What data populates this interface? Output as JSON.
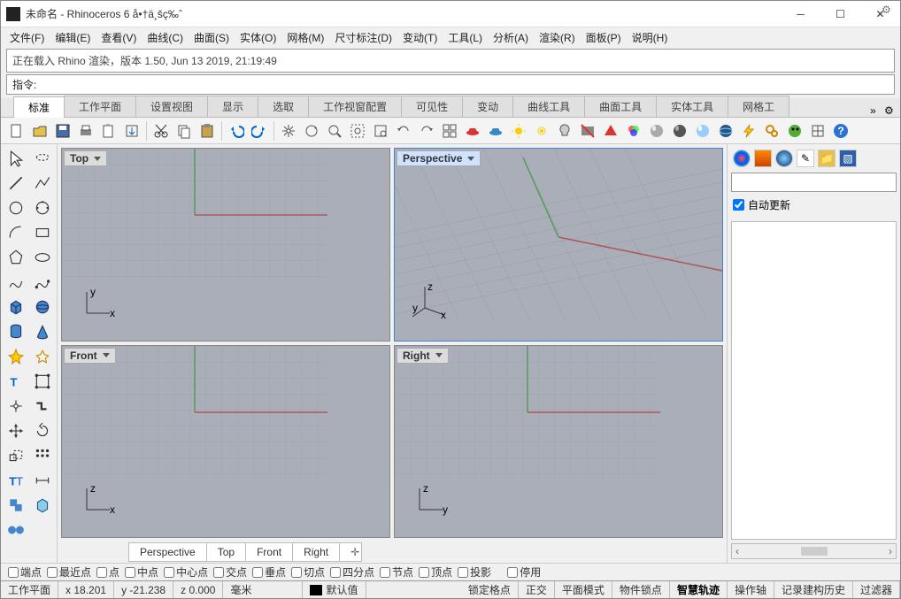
{
  "title": "未命名 - Rhinoceros 6 å•†ä¸šç‰ˆ",
  "menu": [
    "文件(F)",
    "编辑(E)",
    "查看(V)",
    "曲线(C)",
    "曲面(S)",
    "实体(O)",
    "网格(M)",
    "尺寸标注(D)",
    "变动(T)",
    "工具(L)",
    "分析(A)",
    "渲染(R)",
    "面板(P)",
    "说明(H)"
  ],
  "message": "正在载入 Rhino 渲染，版本 1.50, Jun 13 2019, 21:19:49",
  "command_label": "指令:",
  "command_value": "",
  "tabs": [
    "标准",
    "工作平面",
    "设置视图",
    "显示",
    "选取",
    "工作视窗配置",
    "可见性",
    "变动",
    "曲线工具",
    "曲面工具",
    "实体工具",
    "网格工"
  ],
  "active_tab": 0,
  "viewports": {
    "top": "Top",
    "perspective": "Perspective",
    "front": "Front",
    "right": "Right"
  },
  "viewtabs": [
    "Perspective",
    "Top",
    "Front",
    "Right"
  ],
  "right": {
    "auto_update": "自动更新",
    "auto_update_checked": true
  },
  "osnap": [
    {
      "label": "端点",
      "v": false
    },
    {
      "label": "最近点",
      "v": false
    },
    {
      "label": "点",
      "v": false
    },
    {
      "label": "中点",
      "v": false
    },
    {
      "label": "中心点",
      "v": false
    },
    {
      "label": "交点",
      "v": false
    },
    {
      "label": "垂点",
      "v": false
    },
    {
      "label": "切点",
      "v": false
    },
    {
      "label": "四分点",
      "v": false
    },
    {
      "label": "节点",
      "v": false
    },
    {
      "label": "顶点",
      "v": false
    },
    {
      "label": "投影",
      "v": false
    }
  ],
  "osnap_disable": "停用",
  "status": {
    "cplane": "工作平面",
    "x": "x 18.201",
    "y": "y -21.238",
    "z": "z 0.000",
    "units": "毫米",
    "layer": "默认值",
    "items": [
      "锁定格点",
      "正交",
      "平面模式",
      "物件锁点",
      "智慧轨迹",
      "操作轴",
      "记录建构历史",
      "过滤器"
    ],
    "bold_item": "智慧轨迹"
  }
}
